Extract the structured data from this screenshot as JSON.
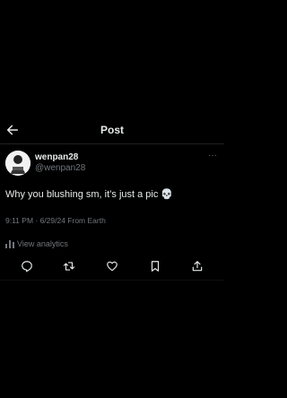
{
  "header": {
    "title": "Post",
    "back_icon": "arrow-left-icon"
  },
  "tweet": {
    "display_name": "wenpan28",
    "handle": "@wenpan28",
    "text": "Why you blushing sm, it’s just a pic 💀",
    "meta": "9:11 PM · 6/29/24 From Earth",
    "analytics_label": "View analytics"
  },
  "colors": {
    "background": "#000000",
    "primary_text": "#e7e9ea",
    "secondary_text": "#71767b"
  },
  "actions": [
    "reply-icon",
    "repost-icon",
    "like-icon",
    "bookmark-icon",
    "share-icon"
  ]
}
